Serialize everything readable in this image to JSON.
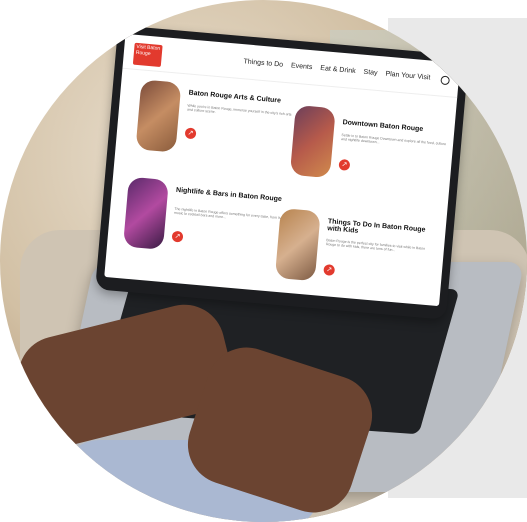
{
  "website": {
    "logo_text": "Visit Baton Rouge",
    "nav": [
      "Things to Do",
      "Events",
      "Eat & Drink",
      "Stay",
      "Plan Your Visit"
    ]
  },
  "cards": [
    {
      "title": "Baton Rouge Arts & Culture",
      "desc": "While you're in Baton Rouge, immerse yourself in the city's rich arts and culture scene."
    },
    {
      "title": "Downtown Baton Rouge",
      "desc": "Settle in to Baton Rouge Downtown and explore all the food, culture and nightlife downtown..."
    },
    {
      "title": "Nightlife & Bars in Baton Rouge",
      "desc": "The nightlife in Baton Rouge offers something for every taste, from live music to cocktail bars and more..."
    },
    {
      "title": "Things To Do In Baton Rouge with Kids",
      "desc": "Baton Rouge is the perfect city for families to visit while in Baton Rouge to do with kids, there are tons of fun..."
    }
  ],
  "colors": {
    "accent": "#e23a2e"
  }
}
